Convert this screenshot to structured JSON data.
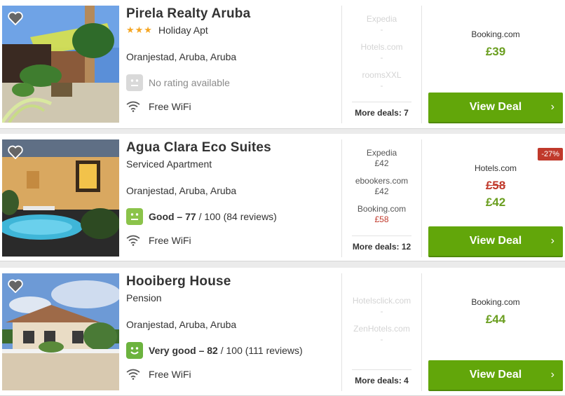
{
  "hotels": [
    {
      "name": "Pirela Realty Aruba",
      "stars": "★★★",
      "type": "Holiday Apt",
      "location": "Oranjestad, Aruba, Aruba",
      "rating_text": "No rating available",
      "amenity": "Free WiFi",
      "deals": [
        {
          "name": "Expedia",
          "price": "-"
        },
        {
          "name": "Hotels.com",
          "price": "-"
        },
        {
          "name": "roomsXXL",
          "price": "-"
        }
      ],
      "more_deals": "More deals: 7",
      "provider": "Booking.com",
      "price": "£39",
      "cta": "View Deal"
    },
    {
      "name": "Agua Clara Eco Suites",
      "type": "Serviced Apartment",
      "location": "Oranjestad, Aruba, Aruba",
      "rating_label": "Good – 77",
      "rating_score": " / 100 (84 reviews)",
      "amenity": "Free WiFi",
      "deals": [
        {
          "name": "Expedia",
          "price": "£42"
        },
        {
          "name": "ebookers.com",
          "price": "£42"
        },
        {
          "name": "Booking.com",
          "price": "£58"
        }
      ],
      "more_deals": "More deals: 12",
      "discount": "-27%",
      "provider": "Hotels.com",
      "old_price": "£58",
      "price": "£42",
      "cta": "View Deal"
    },
    {
      "name": "Hooiberg House",
      "type": "Pension",
      "location": "Oranjestad, Aruba, Aruba",
      "rating_label": "Very good – 82",
      "rating_score": " / 100 (111 reviews)",
      "amenity": "Free WiFi",
      "deals": [
        {
          "name": "Hotelsclick.com",
          "price": "-"
        },
        {
          "name": "ZenHotels.com",
          "price": "-"
        }
      ],
      "more_deals": "More deals: 4",
      "provider": "Booking.com",
      "price": "£44",
      "cta": "View Deal"
    }
  ],
  "colors": {
    "accent": "#62a60a",
    "price_green": "#6a9e1f",
    "discount_red": "#c0392b",
    "stars": "#f5a623"
  }
}
